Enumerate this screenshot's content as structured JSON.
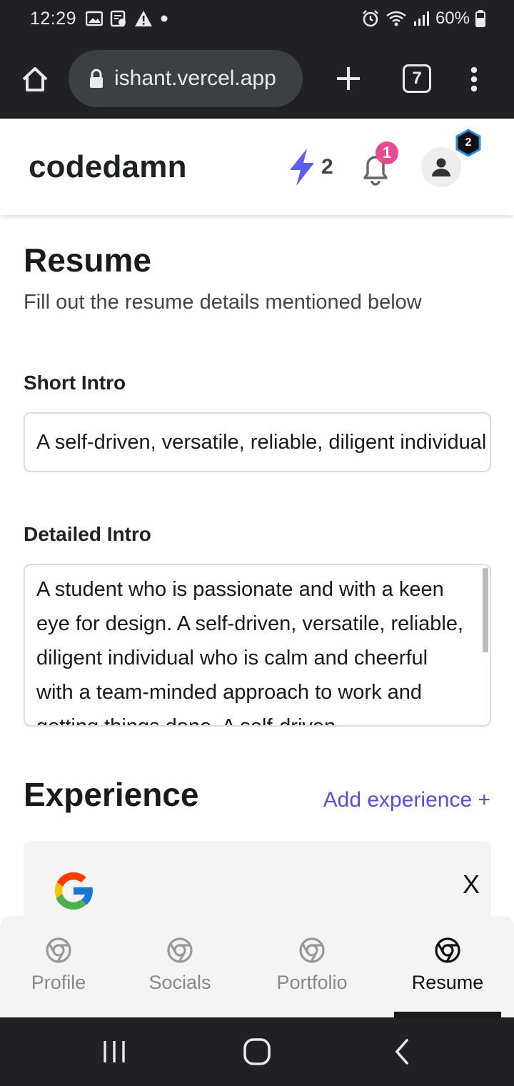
{
  "status_bar": {
    "time": "12:29",
    "battery": "60%"
  },
  "browser": {
    "url": "ishant.vercel.app",
    "tab_count": "7"
  },
  "header": {
    "logo": "codedamn",
    "bolt_count": "2",
    "notifications_count": "1",
    "avatar_badge": "2"
  },
  "page": {
    "title": "Resume",
    "subtitle": "Fill out the resume details mentioned below",
    "short_intro_label": "Short Intro",
    "short_intro_value": "A self-driven, versatile, reliable, diligent individual who is calm and cheerful with a team-minded approach to work",
    "detailed_intro_label": "Detailed Intro",
    "detailed_intro_value": "A student who is passionate and with a keen eye for design. A self-driven, versatile, reliable, diligent individual who is calm and cheerful with a team-minded approach to work and getting things done. A self-driven",
    "experience_title": "Experience",
    "add_experience": "Add experience +",
    "experience_remove": "X"
  },
  "bottom_nav": {
    "tabs": [
      {
        "label": "Profile"
      },
      {
        "label": "Socials"
      },
      {
        "label": "Portfolio"
      },
      {
        "label": "Resume"
      }
    ],
    "active": "Resume"
  },
  "colors": {
    "accent": "#5a4fcf",
    "notification": "#e64b8f",
    "bolt": "#5b5cf0",
    "dark_chrome": "#202124"
  }
}
